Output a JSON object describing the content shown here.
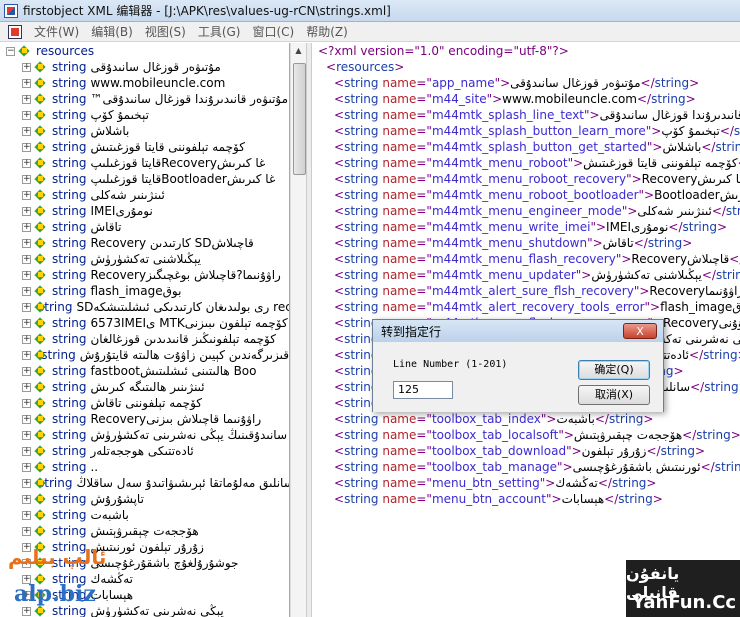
{
  "window": {
    "title": "firstobject XML 编辑器 - [J:\\APK\\res\\values-ug-rCN\\strings.xml]"
  },
  "menu": [
    "文件(W)",
    "编辑(B)",
    "视图(S)",
    "工具(G)",
    "窗口(C)",
    "帮助(Z)"
  ],
  "tree": {
    "root": "resources",
    "items": [
      {
        "tag": "string",
        "value": "مۇتىۋەر قوزغال سانىدۇقى"
      },
      {
        "tag": "string",
        "value": "www.mobileuncle.com"
      },
      {
        "tag": "string",
        "value": "™مۇتىۋەر قانىدىرۇندا قوزغال سانىدۇقى"
      },
      {
        "tag": "string",
        "value": "تېخىمۇ كۆپ"
      },
      {
        "tag": "string",
        "value": "باشلاش"
      },
      {
        "tag": "string",
        "value": "كۆچمە تېلفوننى قايتا قوزغىتىش"
      },
      {
        "tag": "string",
        "value": "قايتا قوزغىلىپRecoveryغا كىرىش"
      },
      {
        "tag": "string",
        "value": "قايتا قوزغىلىپBootloaderغا كىرىش"
      },
      {
        "tag": "string",
        "value": "ئىنژىنىر شەكلى"
      },
      {
        "tag": "string",
        "value": "IMEIنومۇرى"
      },
      {
        "tag": "string",
        "value": "تاقاش"
      },
      {
        "tag": "string",
        "value": "Recovery كارتىدىن SDقاچىلاش"
      },
      {
        "tag": "string",
        "value": "يېڭىلاشنى تەكشۈرۈش"
      },
      {
        "tag": "string",
        "value": "Recoveryراۋۇنىما?قاچىلاش بوغچىگىز"
      },
      {
        "tag": "string",
        "value": "flash_imageبوق"
      },
      {
        "tag": "string",
        "value": "SDرى بولىدىغان كارتىدىكى ئىشلىتىشكە rec"
      },
      {
        "tag": "string",
        "value": "6573IMEIى MTKكۆچمە تېلفون ىبىزنى"
      },
      {
        "tag": "string",
        "value": "كۆچمە تېلفونىڭىز قانىدىدىن قوزغالغان"
      },
      {
        "tag": "string",
        "value": "قىزىرگەندىن كېيىن زاۋۇت ھالىتە قايتۇرۇش"
      },
      {
        "tag": "string",
        "value": "fastbootھالىتىنى ئىشلىتىش Boo"
      },
      {
        "tag": "string",
        "value": "ئىنژىنىر ھالىتىگە كىرىش"
      },
      {
        "tag": "string",
        "value": "كۆچمە تېلفوننى تاقاش"
      },
      {
        "tag": "string",
        "value": "Recoveryراۋۇنىما قاچىلاش بىزنى"
      },
      {
        "tag": "string",
        "value": "سانىدۇقىنىڭ يېڭى نەشرىنى تەكشۈرۈش"
      },
      {
        "tag": "string",
        "value": "ئادەتتىكى ھوججەتلەر"
      },
      {
        "tag": "string",
        "value": ".."
      },
      {
        "tag": "string",
        "value": "سانلىق مەلۇماتقا ئېرىشىۋاتىدۇ سەل ساقلاڭ"
      },
      {
        "tag": "string",
        "value": "تاپشۇرۇش"
      },
      {
        "tag": "string",
        "value": "باشبەت"
      },
      {
        "tag": "string",
        "value": "ھۆججەت چېقىرۋېتىش"
      },
      {
        "tag": "string",
        "value": "زۇرۇر تېلفون ئورنىتىش"
      },
      {
        "tag": "string",
        "value": "جوشۇرۇلغۇچ باشقۇرغۇچىسى"
      },
      {
        "tag": "string",
        "value": "تەڭشەك"
      },
      {
        "tag": "string",
        "value": "ھېسابات"
      },
      {
        "tag": "string",
        "value": "يېڭى نەشرىنى تەكشۈرۈش"
      }
    ]
  },
  "xml": {
    "decl": "<?xml version=\"1.0\" encoding=\"utf-8\"?>",
    "root_open": "resources",
    "lines": [
      {
        "name": "app_name",
        "text": "مۇتىۋەر قوزغال سانىدۇقى"
      },
      {
        "name": "m44_site",
        "text": "www.mobileuncle.com"
      },
      {
        "name": "m44mtk_splash_line_text",
        "text": "قانىدىرۇندا قوزغال سانىدۇقى"
      },
      {
        "name": "m44mtk_splash_button_learn_more",
        "text": "تېخىمۇ كۆپ"
      },
      {
        "name": "m44mtk_splash_button_get_started",
        "text": "باشلاش"
      },
      {
        "name": "m44mtk_menu_roboot",
        "text": "كۆچمە تېلفوننى قايتا قوزغىتىش"
      },
      {
        "name": "m44mtk_menu_roboot_recovery",
        "text": "Recoveryغا كىرىش"
      },
      {
        "name": "m44mtk_menu_roboot_bootloader",
        "text": "Bootloaderغا كىرىش"
      },
      {
        "name": "m44mtk_menu_engineer_mode",
        "text": "ئىنژىنىر شەكلى"
      },
      {
        "name": "m44mtk_menu_write_imei",
        "text": "IMEIنومۇرى"
      },
      {
        "name": "m44mtk_menu_shutdown",
        "text": "تاقاش"
      },
      {
        "name": "m44mtk_menu_flash_recovery",
        "text": "Recoveryقاچىلاش"
      },
      {
        "name": "m44mtk_menu_updater",
        "text": "يېڭىلاشنى تەكشۈرۈش"
      },
      {
        "name": "m44mtk_alert_sure_flsh_recovery",
        "text": "Recoveryراۋۇنىما?"
      },
      {
        "name": "m44mtk_alert_recovery_tools_error",
        "text": "flash_imageبوق"
      },
      {
        "name": "m44mtk_menu_flash_recovery_msg",
        "text": "Recoveryراۋۇنى"
      },
      {
        "name": "m44mtk_menu_updater_msg",
        "text": "سانىدۇقىنىڭ يېڭى نەشرىنى تەكشۈرۈش"
      },
      {
        "name": "m44mtk_menu_topapk",
        "text": "ئادەتتىكى ھوججەتلەر"
      },
      {
        "name": "m44mtk_menu_topapk_msg",
        "text": ".."
      },
      {
        "name": "wait",
        "text": "سانلىق مەلۇماتقا ئېرىشىۋاتىدۇ سەل ساقلاڭ"
      },
      {
        "name": "str_submit_btn",
        "text": "تاپشۇرۇش"
      },
      {
        "name": "toolbox_tab_index",
        "text": "باشبەت"
      },
      {
        "name": "toolbox_tab_localsoft",
        "text": "ھۆججەت چېقىرۋېتىش"
      },
      {
        "name": "toolbox_tab_download",
        "text": "زۇرۇر تېلفون"
      },
      {
        "name": "toolbox_tab_manage",
        "text": "ئورنىتىش باشقۇرغۇچىسى"
      },
      {
        "name": "menu_btn_setting",
        "text": "تەڭشەك"
      },
      {
        "name": "menu_btn_account",
        "text": "ھېسابات"
      }
    ]
  },
  "dialog": {
    "title": "转到指定行",
    "close": "X",
    "label": "Line Number (1-201)",
    "input_value": "125",
    "ok": "确定(Q)",
    "cancel": "取消(X)"
  },
  "watermarks": {
    "left_script": "ئالپ بىلىم",
    "left_domain": "alp.biz",
    "right_script": "يانفۇن قانىلى",
    "right_domain": "YanFun.Cc"
  }
}
